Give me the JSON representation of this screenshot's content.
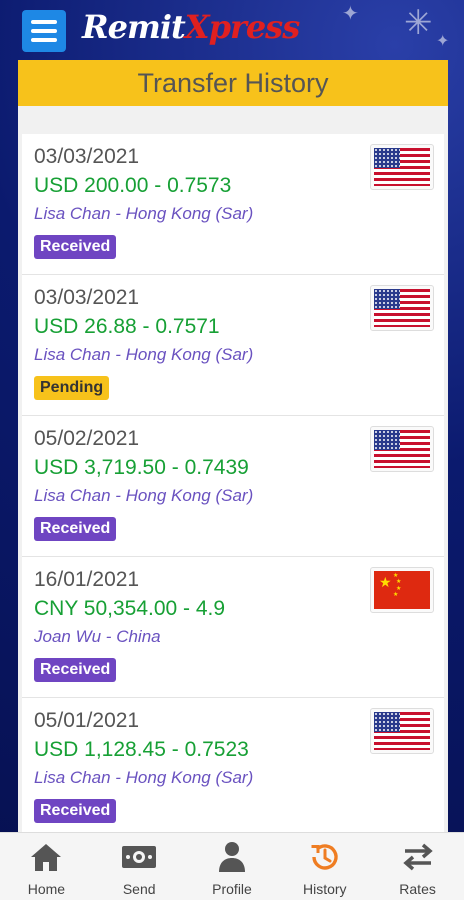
{
  "brand": {
    "logo_part1": "Remit",
    "logo_part2": "Xpress"
  },
  "page": {
    "title": "Transfer History"
  },
  "colors": {
    "header_bar": "#f7c21b",
    "amount": "#17a035",
    "recipient": "#6a52c0",
    "received_badge": "#6f45c2",
    "pending_badge": "#f7c21b",
    "active_nav": "#ef7d22"
  },
  "transfers": [
    {
      "date": "03/03/2021",
      "amount": "USD 200.00 - 0.7573",
      "recipient": "Lisa Chan - Hong Kong (Sar)",
      "status": "Received",
      "flag": "us-flag-icon"
    },
    {
      "date": "03/03/2021",
      "amount": "USD 26.88 - 0.7571",
      "recipient": "Lisa Chan - Hong Kong (Sar)",
      "status": "Pending",
      "flag": "us-flag-icon"
    },
    {
      "date": "05/02/2021",
      "amount": "USD 3,719.50 - 0.7439",
      "recipient": "Lisa Chan - Hong Kong (Sar)",
      "status": "Received",
      "flag": "us-flag-icon"
    },
    {
      "date": "16/01/2021",
      "amount": "CNY 50,354.00 - 4.9",
      "recipient": "Joan Wu - China",
      "status": "Received",
      "flag": "china-flag-icon"
    },
    {
      "date": "05/01/2021",
      "amount": "USD 1,128.45 - 0.7523",
      "recipient": "Lisa Chan - Hong Kong (Sar)",
      "status": "Received",
      "flag": "us-flag-icon"
    }
  ],
  "nav": {
    "items": [
      {
        "label": "Home",
        "icon": "home-icon"
      },
      {
        "label": "Send",
        "icon": "money-icon"
      },
      {
        "label": "Profile",
        "icon": "person-icon"
      },
      {
        "label": "History",
        "icon": "history-icon",
        "active": true
      },
      {
        "label": "Rates",
        "icon": "exchange-icon"
      }
    ]
  }
}
